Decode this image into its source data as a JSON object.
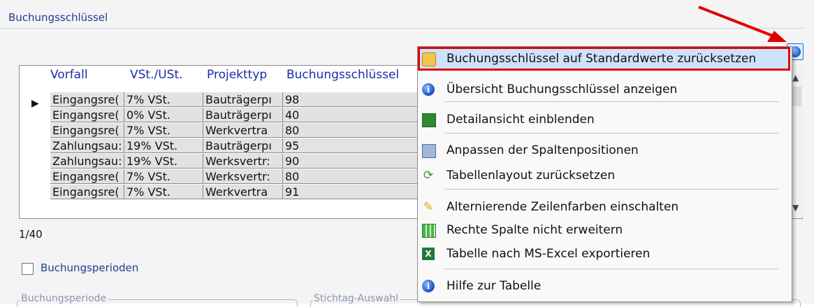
{
  "section": {
    "title": "Buchungsschlüssel"
  },
  "table": {
    "columns": [
      "Vorfall",
      "VSt./USt.",
      "Projekttyp",
      "Buchungsschlüssel"
    ],
    "rows": [
      [
        "Eingangsre(",
        "7% VSt.",
        "Bauträgerpı",
        "98"
      ],
      [
        "Eingangsre(",
        "0% VSt.",
        "Bauträgerpı",
        "40"
      ],
      [
        "Eingangsre(",
        "7% VSt.",
        "Werkvertra",
        "80"
      ],
      [
        "Zahlungsau:",
        "19% VSt.",
        "Bauträgerpı",
        "95"
      ],
      [
        "Zahlungsau:",
        "19% VSt.",
        "Werksvertr:",
        "90"
      ],
      [
        "Eingangsre(",
        "7% VSt.",
        "Werksvertr:",
        "80"
      ],
      [
        "Eingangsre(",
        "7% VSt.",
        "Werkvertra",
        "91"
      ]
    ],
    "current_row_indicator": "▶"
  },
  "record_counter": "1/40",
  "checkbox": {
    "label": "Buchungsperioden",
    "checked": false
  },
  "groups": {
    "left": "Buchungsperiode",
    "right": "Stichtag-Auswahl"
  },
  "context_menu": {
    "items": [
      {
        "label": "Buchungsschlüssel auf Standardwerte zurücksetzen",
        "icon": "reset-database-icon",
        "highlighted": true
      },
      {
        "label": "Übersicht Buchungsschlüssel anzeigen",
        "icon": "info-icon"
      },
      {
        "label": "Detailansicht einblenden",
        "icon": "detail-view-icon"
      },
      {
        "label": "Anpassen der Spaltenpositionen",
        "icon": "columns-icon"
      },
      {
        "label": "Tabellenlayout zurücksetzen",
        "icon": "refresh-icon"
      },
      {
        "label": "Alternierende Zeilenfarben einschalten",
        "icon": "alternate-rows-icon"
      },
      {
        "label": "Rechte Spalte nicht erweitern",
        "icon": "grid-icon"
      },
      {
        "label": "Tabelle nach MS-Excel exportieren",
        "icon": "excel-icon"
      },
      {
        "label": "Hilfe zur Tabelle",
        "icon": "help-icon"
      }
    ]
  },
  "colors": {
    "highlight_border": "#e00000",
    "arrow": "#e00000",
    "header_text": "#1a2fa8"
  }
}
